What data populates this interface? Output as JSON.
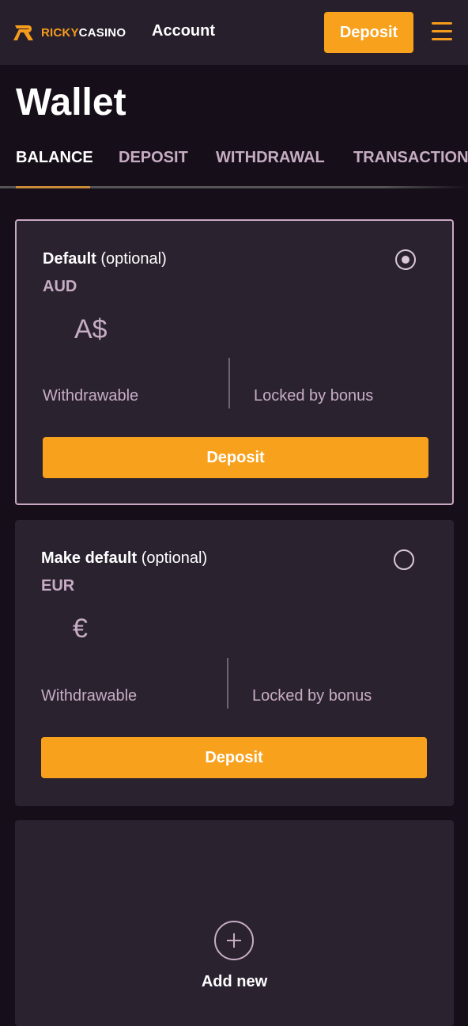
{
  "header": {
    "brand_part1": "RICKY",
    "brand_part2": "CASINO",
    "account_label": "Account",
    "deposit_label": "Deposit",
    "brand_color": "#f59c1c"
  },
  "page": {
    "title": "Wallet"
  },
  "tabs": [
    {
      "label": "BALANCE",
      "active": true
    },
    {
      "label": "DEPOSIT",
      "active": false
    },
    {
      "label": "WITHDRAWAL",
      "active": false
    },
    {
      "label": "TRANSACTIONS",
      "active": false
    }
  ],
  "wallets": [
    {
      "title_bold": "Default",
      "title_suffix": "(optional)",
      "currency": "AUD",
      "symbol": "A$",
      "selected": true,
      "withdrawable_label": "Withdrawable",
      "locked_label": "Locked by bonus",
      "deposit_label": "Deposit"
    },
    {
      "title_bold": "Make default",
      "title_suffix": "(optional)",
      "currency": "EUR",
      "symbol": "€",
      "selected": false,
      "withdrawable_label": "Withdrawable",
      "locked_label": "Locked by bonus",
      "deposit_label": "Deposit"
    }
  ],
  "add_new": {
    "label": "Add new",
    "icon": "plus-icon"
  },
  "colors": {
    "accent": "#f8a11c",
    "background": "#160f19",
    "card": "#2b2230",
    "muted_text": "#c7adc4"
  }
}
